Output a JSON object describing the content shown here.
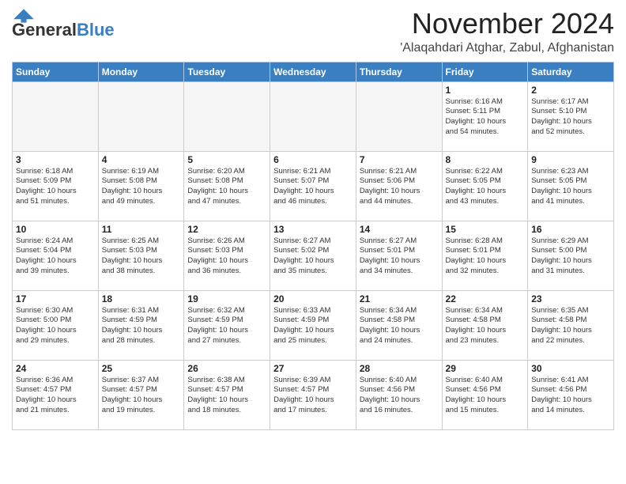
{
  "header": {
    "logo_general": "General",
    "logo_blue": "Blue",
    "month_title": "November 2024",
    "location": "'Alaqahdari Atghar, Zabul, Afghanistan"
  },
  "days_of_week": [
    "Sunday",
    "Monday",
    "Tuesday",
    "Wednesday",
    "Thursday",
    "Friday",
    "Saturday"
  ],
  "weeks": [
    [
      {
        "day": "",
        "info": ""
      },
      {
        "day": "",
        "info": ""
      },
      {
        "day": "",
        "info": ""
      },
      {
        "day": "",
        "info": ""
      },
      {
        "day": "",
        "info": ""
      },
      {
        "day": "1",
        "info": "Sunrise: 6:16 AM\nSunset: 5:11 PM\nDaylight: 10 hours\nand 54 minutes."
      },
      {
        "day": "2",
        "info": "Sunrise: 6:17 AM\nSunset: 5:10 PM\nDaylight: 10 hours\nand 52 minutes."
      }
    ],
    [
      {
        "day": "3",
        "info": "Sunrise: 6:18 AM\nSunset: 5:09 PM\nDaylight: 10 hours\nand 51 minutes."
      },
      {
        "day": "4",
        "info": "Sunrise: 6:19 AM\nSunset: 5:08 PM\nDaylight: 10 hours\nand 49 minutes."
      },
      {
        "day": "5",
        "info": "Sunrise: 6:20 AM\nSunset: 5:08 PM\nDaylight: 10 hours\nand 47 minutes."
      },
      {
        "day": "6",
        "info": "Sunrise: 6:21 AM\nSunset: 5:07 PM\nDaylight: 10 hours\nand 46 minutes."
      },
      {
        "day": "7",
        "info": "Sunrise: 6:21 AM\nSunset: 5:06 PM\nDaylight: 10 hours\nand 44 minutes."
      },
      {
        "day": "8",
        "info": "Sunrise: 6:22 AM\nSunset: 5:05 PM\nDaylight: 10 hours\nand 43 minutes."
      },
      {
        "day": "9",
        "info": "Sunrise: 6:23 AM\nSunset: 5:05 PM\nDaylight: 10 hours\nand 41 minutes."
      }
    ],
    [
      {
        "day": "10",
        "info": "Sunrise: 6:24 AM\nSunset: 5:04 PM\nDaylight: 10 hours\nand 39 minutes."
      },
      {
        "day": "11",
        "info": "Sunrise: 6:25 AM\nSunset: 5:03 PM\nDaylight: 10 hours\nand 38 minutes."
      },
      {
        "day": "12",
        "info": "Sunrise: 6:26 AM\nSunset: 5:03 PM\nDaylight: 10 hours\nand 36 minutes."
      },
      {
        "day": "13",
        "info": "Sunrise: 6:27 AM\nSunset: 5:02 PM\nDaylight: 10 hours\nand 35 minutes."
      },
      {
        "day": "14",
        "info": "Sunrise: 6:27 AM\nSunset: 5:01 PM\nDaylight: 10 hours\nand 34 minutes."
      },
      {
        "day": "15",
        "info": "Sunrise: 6:28 AM\nSunset: 5:01 PM\nDaylight: 10 hours\nand 32 minutes."
      },
      {
        "day": "16",
        "info": "Sunrise: 6:29 AM\nSunset: 5:00 PM\nDaylight: 10 hours\nand 31 minutes."
      }
    ],
    [
      {
        "day": "17",
        "info": "Sunrise: 6:30 AM\nSunset: 5:00 PM\nDaylight: 10 hours\nand 29 minutes."
      },
      {
        "day": "18",
        "info": "Sunrise: 6:31 AM\nSunset: 4:59 PM\nDaylight: 10 hours\nand 28 minutes."
      },
      {
        "day": "19",
        "info": "Sunrise: 6:32 AM\nSunset: 4:59 PM\nDaylight: 10 hours\nand 27 minutes."
      },
      {
        "day": "20",
        "info": "Sunrise: 6:33 AM\nSunset: 4:59 PM\nDaylight: 10 hours\nand 25 minutes."
      },
      {
        "day": "21",
        "info": "Sunrise: 6:34 AM\nSunset: 4:58 PM\nDaylight: 10 hours\nand 24 minutes."
      },
      {
        "day": "22",
        "info": "Sunrise: 6:34 AM\nSunset: 4:58 PM\nDaylight: 10 hours\nand 23 minutes."
      },
      {
        "day": "23",
        "info": "Sunrise: 6:35 AM\nSunset: 4:58 PM\nDaylight: 10 hours\nand 22 minutes."
      }
    ],
    [
      {
        "day": "24",
        "info": "Sunrise: 6:36 AM\nSunset: 4:57 PM\nDaylight: 10 hours\nand 21 minutes."
      },
      {
        "day": "25",
        "info": "Sunrise: 6:37 AM\nSunset: 4:57 PM\nDaylight: 10 hours\nand 19 minutes."
      },
      {
        "day": "26",
        "info": "Sunrise: 6:38 AM\nSunset: 4:57 PM\nDaylight: 10 hours\nand 18 minutes."
      },
      {
        "day": "27",
        "info": "Sunrise: 6:39 AM\nSunset: 4:57 PM\nDaylight: 10 hours\nand 17 minutes."
      },
      {
        "day": "28",
        "info": "Sunrise: 6:40 AM\nSunset: 4:56 PM\nDaylight: 10 hours\nand 16 minutes."
      },
      {
        "day": "29",
        "info": "Sunrise: 6:40 AM\nSunset: 4:56 PM\nDaylight: 10 hours\nand 15 minutes."
      },
      {
        "day": "30",
        "info": "Sunrise: 6:41 AM\nSunset: 4:56 PM\nDaylight: 10 hours\nand 14 minutes."
      }
    ]
  ]
}
